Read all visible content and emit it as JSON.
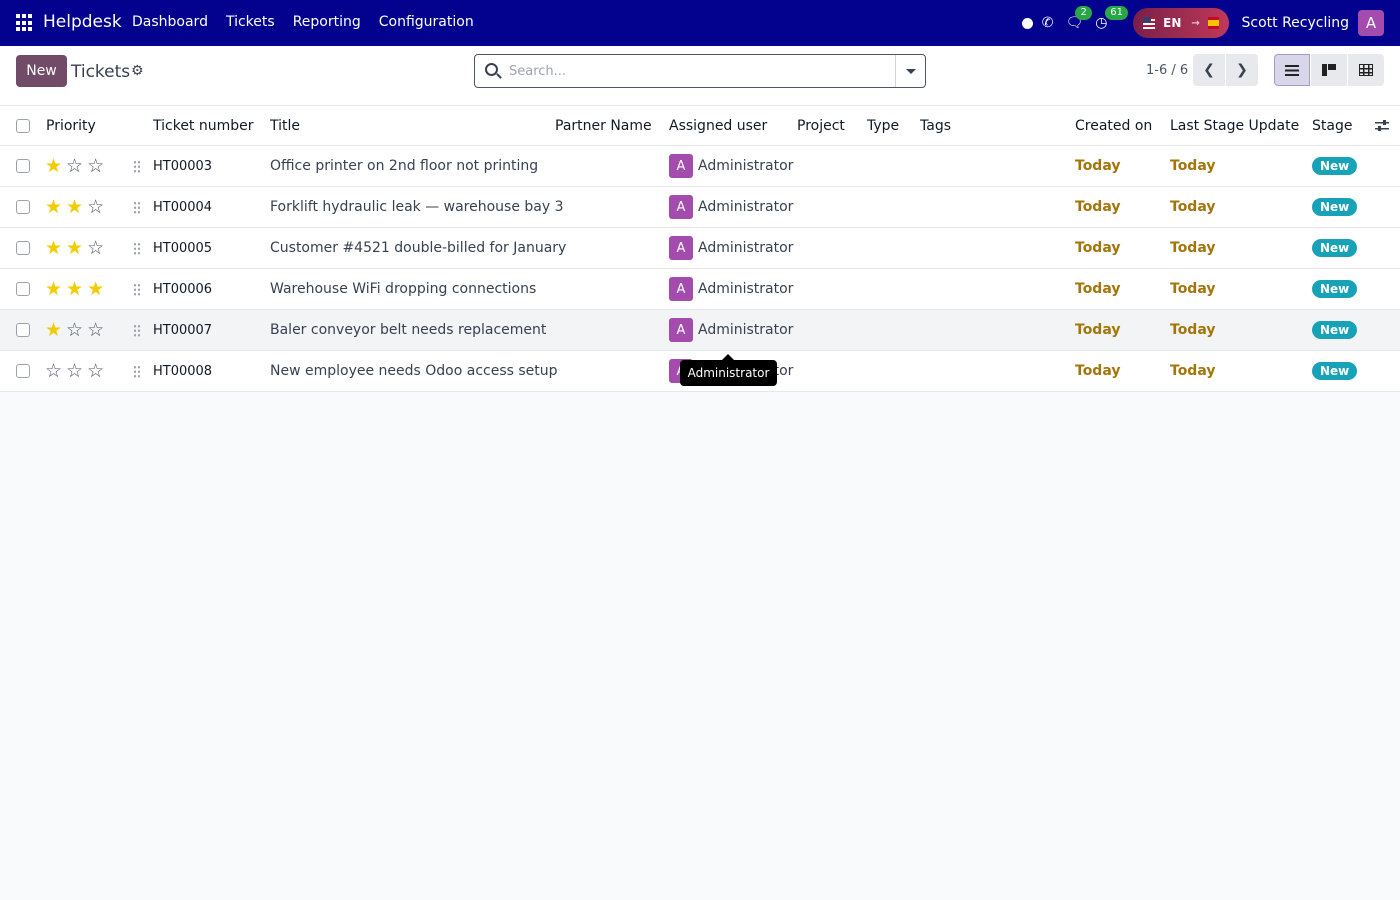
{
  "navbar": {
    "app_name": "Helpdesk",
    "menu": [
      "Dashboard",
      "Tickets",
      "Reporting",
      "Configuration"
    ],
    "chat_count": "2",
    "activity_count": "61",
    "language": "EN",
    "company": "Scott Recycling",
    "user_initial": "A"
  },
  "control": {
    "new_label": "New",
    "title": "Tickets",
    "search_placeholder": "Search...",
    "pager": "1-6 / 6"
  },
  "columns": {
    "priority": "Priority",
    "ticket_number": "Ticket number",
    "title": "Title",
    "partner": "Partner Name",
    "assigned": "Assigned user",
    "project": "Project",
    "type": "Type",
    "tags": "Tags",
    "created": "Created on",
    "last_stage": "Last Stage Update",
    "stage": "Stage"
  },
  "rows": [
    {
      "priority": 1,
      "number": "HT00003",
      "title": "Office printer on 2nd floor not printing",
      "user_initial": "A",
      "user": "Administrator",
      "created": "Today",
      "last_stage": "Today",
      "stage": "New"
    },
    {
      "priority": 2,
      "number": "HT00004",
      "title": "Forklift hydraulic leak — warehouse bay 3",
      "user_initial": "A",
      "user": "Administrator",
      "created": "Today",
      "last_stage": "Today",
      "stage": "New"
    },
    {
      "priority": 2,
      "number": "HT00005",
      "title": "Customer #4521 double-billed for January",
      "user_initial": "A",
      "user": "Administrator",
      "created": "Today",
      "last_stage": "Today",
      "stage": "New"
    },
    {
      "priority": 3,
      "number": "HT00006",
      "title": "Warehouse WiFi dropping connections",
      "user_initial": "A",
      "user": "Administrator",
      "created": "Today",
      "last_stage": "Today",
      "stage": "New"
    },
    {
      "priority": 1,
      "number": "HT00007",
      "title": "Baler conveyor belt needs replacement",
      "user_initial": "A",
      "user": "Administrator",
      "created": "Today",
      "last_stage": "Today",
      "stage": "New"
    },
    {
      "priority": 0,
      "number": "HT00008",
      "title": "New employee needs Odoo access setup",
      "user_initial": "A",
      "user": "Administrator",
      "created": "Today",
      "last_stage": "Today",
      "stage": "New"
    }
  ],
  "tooltip": "Administrator",
  "colors": {
    "navbar": "#02028f",
    "primary": "#714b67",
    "date": "#a3750a",
    "stage": "#17a2b8",
    "avatar": "#a44cad",
    "star": "#f3cc00"
  }
}
